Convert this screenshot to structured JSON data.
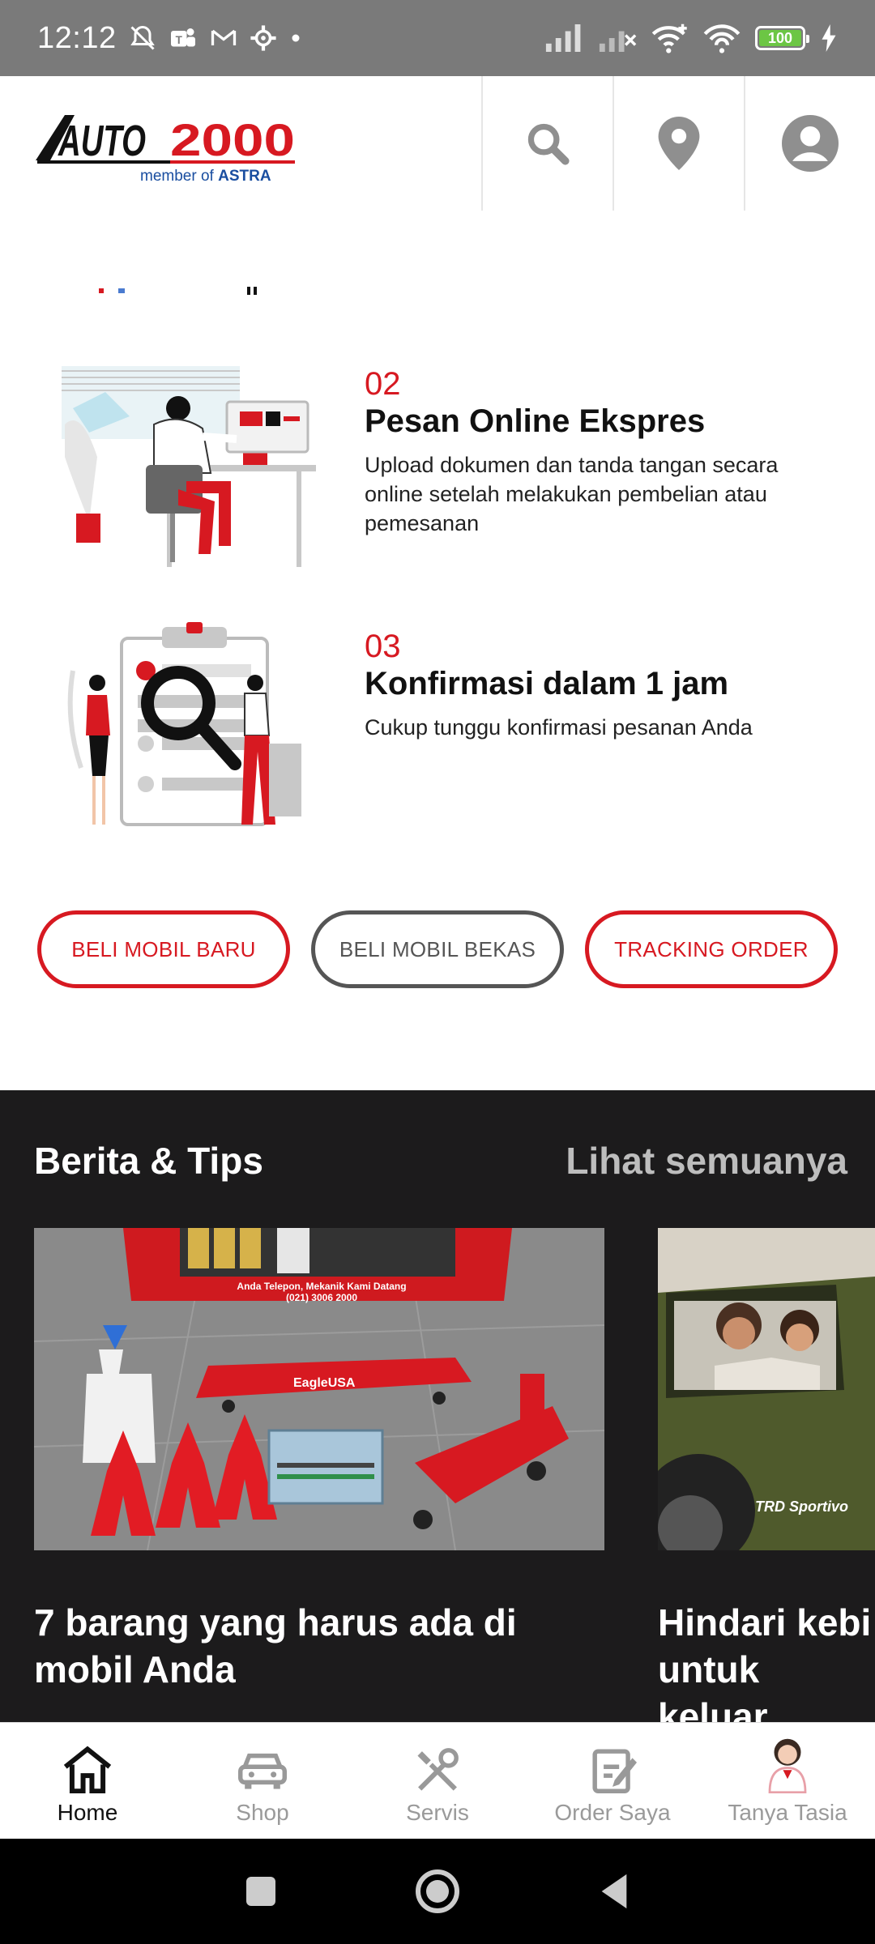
{
  "status_bar": {
    "time": "12:12",
    "battery": "100",
    "icons": [
      "mute-icon",
      "teams-icon",
      "gmail-icon",
      "settings-icon",
      "dot-icon",
      "signal-icon",
      "signal-x-icon",
      "wifi-plus-icon",
      "wifi-icon",
      "battery-icon",
      "charging-icon"
    ]
  },
  "header": {
    "logo_text": "AUTO 2000",
    "logo_sub": "member of ASTRA",
    "icons": [
      "search-icon",
      "location-pin-icon",
      "account-icon"
    ]
  },
  "steps": [
    {
      "num": "02",
      "title": "Pesan Online Ekspres",
      "desc": "Upload dokumen dan tanda tangan secara online setelah melakukan pembelian atau pemesanan"
    },
    {
      "num": "03",
      "title": "Konfirmasi dalam 1 jam",
      "desc": "Cukup tunggu konfirmasi pesanan Anda"
    }
  ],
  "actions": {
    "new_car": "BELI MOBIL BARU",
    "used_car": "BELI MOBIL BEKAS",
    "tracking": "TRACKING ORDER"
  },
  "news": {
    "title": "Berita & Tips",
    "see_all": "Lihat semuanya",
    "cards": [
      {
        "title": "7 barang yang harus ada di mobil Anda",
        "image_text": [
          "Anda Telepon, Mekanik Kami Datang",
          "(021) 3006 2000",
          "EagleUSA"
        ]
      },
      {
        "title": "Hindari kebi untuk keluar",
        "image_text": [
          "TRD Sportivo"
        ]
      }
    ]
  },
  "bottom_nav": {
    "items": [
      {
        "label": "Home",
        "icon": "home-icon",
        "active": true
      },
      {
        "label": "Shop",
        "icon": "car-icon",
        "active": false
      },
      {
        "label": "Servis",
        "icon": "tools-icon",
        "active": false
      },
      {
        "label": "Order Saya",
        "icon": "order-icon",
        "active": false
      },
      {
        "label": "Tanya Tasia",
        "icon": "assistant-avatar-icon",
        "active": false
      }
    ]
  },
  "colors": {
    "brand_red": "#d71921",
    "dark_bg": "#1c1b1c",
    "status_bar": "#7a7a7a"
  }
}
